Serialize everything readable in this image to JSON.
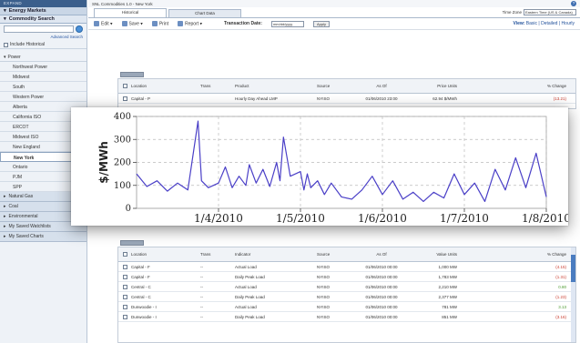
{
  "sidebar": {
    "top_label": "EXPAND",
    "section_title": "Energy Markets",
    "search_title": "Commodity Search",
    "advanced_link": "Advanced Search",
    "include_historical": "Include Historical",
    "power_group": "Power",
    "items": [
      "Northwest Power",
      "Midwest",
      "South",
      "Western Power",
      "Alberta",
      "California ISO",
      "ERCOT",
      "Midwest ISO",
      "New England",
      "New York",
      "Ontario",
      "PJM",
      "SPP"
    ],
    "selected_item": "New York",
    "groups": [
      "Natural Gas",
      "Coal",
      "Environmental",
      "My Saved Watchlists",
      "My Saved Charts"
    ]
  },
  "main": {
    "window_title": "SNL Commodities 1.0 - New York",
    "tabs": [
      "Historical",
      "Chart Data"
    ],
    "time_zone_label": "Time Zone",
    "time_zone_value": "Eastern Time (US & Canada)",
    "toolbar": {
      "edit": "Edit ▾",
      "save": "Save ▾",
      "print": "Print",
      "report": "Report ▾",
      "date_label": "Transaction Date:",
      "date_placeholder": "mm/dd/yyyy",
      "apply": "Apply",
      "view_label": "View:",
      "view_basic": "Basic",
      "view_detailed": "Detailed",
      "view_hourly": "Hourly"
    },
    "top_table": {
      "headers": [
        "Location",
        "Trans",
        "Product",
        "Source",
        "As Of",
        "Price Units",
        "% Change"
      ],
      "row": [
        "Capital - P",
        "",
        "Hourly Day Ahead LMP",
        "NYISO",
        "01/06/2010 23:00",
        "62.94 $/MWh",
        "(13.21)"
      ]
    },
    "bottom_table": {
      "headers": [
        "Location",
        "Trans",
        "Indicator",
        "Source",
        "As Of",
        "Value Units",
        "% Change"
      ],
      "rows": [
        [
          "Capital - F",
          "--",
          "Actual Load",
          "NYISO",
          "01/06/2010 00:00",
          "1,000 MW",
          "(4.15)"
        ],
        [
          "Capital - F",
          "--",
          "Daily Peak Load",
          "NYISO",
          "01/06/2010 00:00",
          "1,783 MW",
          "(1.31)"
        ],
        [
          "Central - C",
          "--",
          "Actual Load",
          "NYISO",
          "01/06/2010 00:00",
          "2,210 MW",
          "0.80"
        ],
        [
          "Central - C",
          "--",
          "Daily Peak Load",
          "NYISO",
          "01/06/2010 00:00",
          "2,377 MW",
          "(1.23)"
        ],
        [
          "Dunwoodie - I",
          "--",
          "Actual Load",
          "NYISO",
          "01/06/2010 00:00",
          "781 MW",
          "3.13"
        ],
        [
          "Dunwoodie - I",
          "--",
          "Daily Peak Load",
          "NYISO",
          "01/06/2010 00:00",
          "851 MW",
          "(3.16)"
        ]
      ]
    }
  },
  "chart_data": {
    "type": "line",
    "title": "",
    "xlabel": "",
    "ylabel": "$/MWh",
    "ylim": [
      0,
      400
    ],
    "yticks": [
      0,
      100,
      200,
      300,
      400
    ],
    "xtick_labels": [
      "1/4/2010",
      "1/5/2010",
      "1/6/2010",
      "1/7/2010",
      "1/8/2010"
    ],
    "grid": true,
    "line_color": "#4a3fc7",
    "x_range": [
      "2010-01-03",
      "2010-01-08"
    ],
    "series": [
      {
        "x": [
          "2010-01-03 00:00",
          "2010-01-03 03:00",
          "2010-01-03 06:00",
          "2010-01-03 09:00",
          "2010-01-03 12:00",
          "2010-01-03 15:00",
          "2010-01-03 18:00",
          "2010-01-03 19:00",
          "2010-01-03 21:00",
          "2010-01-04 00:00",
          "2010-01-04 02:00",
          "2010-01-04 04:00",
          "2010-01-04 06:00",
          "2010-01-04 08:00",
          "2010-01-04 09:00",
          "2010-01-04 11:00",
          "2010-01-04 13:00",
          "2010-01-04 15:00",
          "2010-01-04 17:00",
          "2010-01-04 18:00",
          "2010-01-04 19:00",
          "2010-01-04 21:00",
          "2010-01-05 00:00",
          "2010-01-05 01:00",
          "2010-01-05 02:00",
          "2010-01-05 03:00",
          "2010-01-05 05:00",
          "2010-01-05 07:00",
          "2010-01-05 09:00",
          "2010-01-05 12:00",
          "2010-01-05 15:00",
          "2010-01-05 18:00",
          "2010-01-05 21:00",
          "2010-01-06 00:00",
          "2010-01-06 03:00",
          "2010-01-06 06:00",
          "2010-01-06 09:00",
          "2010-01-06 12:00",
          "2010-01-06 15:00",
          "2010-01-06 18:00",
          "2010-01-06 21:00",
          "2010-01-07 00:00",
          "2010-01-07 03:00",
          "2010-01-07 06:00",
          "2010-01-07 09:00",
          "2010-01-07 12:00",
          "2010-01-07 15:00",
          "2010-01-07 18:00",
          "2010-01-07 21:00",
          "2010-01-08 00:00"
        ],
        "y": [
          150,
          95,
          120,
          75,
          110,
          80,
          380,
          120,
          90,
          110,
          180,
          90,
          140,
          100,
          190,
          110,
          170,
          95,
          200,
          120,
          310,
          140,
          160,
          80,
          150,
          90,
          120,
          60,
          110,
          50,
          40,
          80,
          140,
          60,
          120,
          40,
          70,
          30,
          70,
          45,
          150,
          60,
          110,
          30,
          170,
          80,
          220,
          90,
          240,
          50
        ]
      }
    ]
  }
}
